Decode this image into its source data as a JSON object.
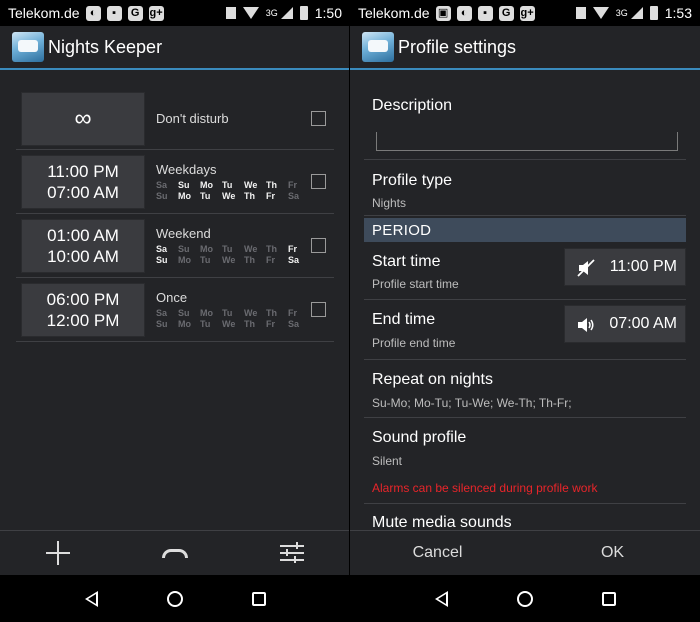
{
  "left": {
    "status": {
      "carrier": "Telekom.de",
      "network": "3G",
      "time": "1:50"
    },
    "app_title": "Nights Keeper",
    "day_headers_top": [
      "Sa",
      "Su",
      "Mo",
      "Tu",
      "We",
      "Th",
      "Fr"
    ],
    "day_headers_bottom": [
      "Su",
      "Mo",
      "Tu",
      "We",
      "Th",
      "Fr",
      "Sa"
    ],
    "profiles": [
      {
        "time_top": "∞",
        "time_bottom": "",
        "name": "Don't disturb",
        "has_days": false
      },
      {
        "time_top": "11:00 PM",
        "time_bottom": "07:00 AM",
        "name": "Weekdays",
        "has_days": true,
        "active_top": [
          false,
          true,
          true,
          true,
          true,
          true,
          false
        ],
        "active_bottom": [
          false,
          true,
          true,
          true,
          true,
          true,
          false
        ]
      },
      {
        "time_top": "01:00 AM",
        "time_bottom": "10:00 AM",
        "name": "Weekend",
        "has_days": true,
        "active_top": [
          true,
          false,
          false,
          false,
          false,
          false,
          true
        ],
        "active_bottom": [
          true,
          false,
          false,
          false,
          false,
          false,
          true
        ]
      },
      {
        "time_top": "06:00 PM",
        "time_bottom": "12:00 PM",
        "name": "Once",
        "has_days": true,
        "active_top": [
          false,
          false,
          false,
          false,
          false,
          false,
          false
        ],
        "active_bottom": [
          false,
          false,
          false,
          false,
          false,
          false,
          false
        ]
      }
    ],
    "bottom_icons": [
      "add-icon",
      "phone-icon",
      "settings-sliders-icon"
    ]
  },
  "right": {
    "status": {
      "carrier": "Telekom.de",
      "network": "3G",
      "time": "1:53"
    },
    "title": "Profile settings",
    "description_label": "Description",
    "description_value": "",
    "profile_type": {
      "title": "Profile type",
      "value": "Nights"
    },
    "period_header": "PERIOD",
    "start_time": {
      "title": "Start time",
      "subtitle": "Profile start time",
      "value": "11:00 PM",
      "icon": "volume-muted-icon"
    },
    "end_time": {
      "title": "End time",
      "subtitle": "Profile end time",
      "value": "07:00 AM",
      "icon": "volume-on-icon"
    },
    "repeat": {
      "title": "Repeat on nights",
      "value": "Su-Mo; Mo-Tu; Tu-We; We-Th; Th-Fr;"
    },
    "sound_profile": {
      "title": "Sound profile",
      "value": "Silent",
      "warning": "Alarms can be silenced during profile work"
    },
    "mute_media": {
      "title": "Mute media sounds"
    },
    "cancel_label": "Cancel",
    "ok_label": "OK",
    "warning_color": "#e8252a",
    "section_color": "#3e4b5b",
    "accent_color": "#3a8bbd"
  }
}
